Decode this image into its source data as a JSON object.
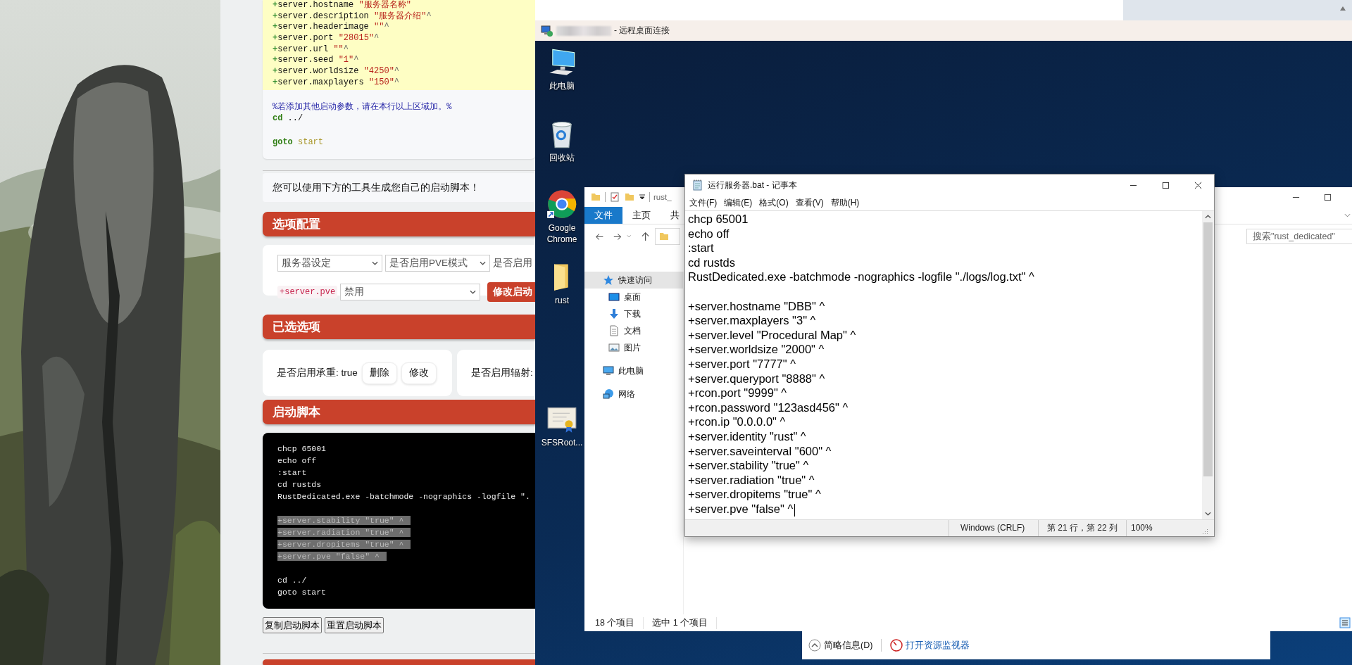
{
  "web_page": {
    "config_lines": [
      {
        "name": "+server.hostname",
        "value": "\"服务器名称\""
      },
      {
        "name": "+server.description",
        "value": "\"服务器介绍\"",
        "tail": "^"
      },
      {
        "name": "+server.headerimage",
        "value": "\"\"",
        "tail": "^"
      },
      {
        "name": "+server.port",
        "value": "\"28015\"",
        "tail": "^"
      },
      {
        "name": "+server.url",
        "value": "\"\"",
        "tail": "^"
      },
      {
        "name": "+server.seed",
        "value": "\"1\"",
        "tail": "^"
      },
      {
        "name": "+server.worldsize",
        "value": "\"4250\"",
        "tail": "^"
      },
      {
        "name": "+server.maxplayers",
        "value": "\"150\"",
        "tail": "^"
      }
    ],
    "comment": "%若添加其他启动参数，请在本行以上区域加。%",
    "footer_lines": [
      {
        "kind": "command",
        "keyword": "cd",
        "arg": "../"
      },
      {
        "kind": "blank"
      },
      {
        "kind": "jump",
        "keyword": "goto",
        "arg": "start"
      }
    ],
    "notice": "您可以使用下方的工具生成您自己的启动脚本！",
    "options_header": "选项配置",
    "selects": [
      "服务器设定",
      "是否启用PVE模式"
    ],
    "select_cut": "是否启用",
    "param_tag": "+server.pve",
    "value_select": "禁用",
    "apply_button": "修改启动",
    "selected_header": "已选选项",
    "selected_items": [
      {
        "label": "是否启用承重: true",
        "actions": [
          "删除",
          "修改"
        ]
      },
      {
        "label": "是否启用辐射:"
      }
    ],
    "script_header": "启动脚本",
    "script_lines": [
      {
        "kind": "text",
        "text": "chcp 65001",
        "highlighted": false
      },
      {
        "kind": "text",
        "text": "echo off",
        "highlighted": false
      },
      {
        "kind": "text",
        "text": ":start",
        "highlighted": false
      },
      {
        "kind": "text",
        "text": "cd rustds",
        "highlighted": false
      },
      {
        "kind": "text",
        "text": "RustDedicated.exe -batchmode -nographics -logfile \".",
        "highlighted": false
      },
      {
        "kind": "blank",
        "highlighted": false
      },
      {
        "kind": "text",
        "text": "+server.stability \"true\" ^",
        "highlighted": true
      },
      {
        "kind": "text",
        "text": "+server.radiation \"true\" ^",
        "highlighted": true
      },
      {
        "kind": "text",
        "text": "+server.dropitems \"true\" ^",
        "highlighted": true
      },
      {
        "kind": "text",
        "text": "+server.pve \"false\" ^",
        "highlighted": true
      },
      {
        "kind": "blank",
        "highlighted": false
      },
      {
        "kind": "text",
        "text": "cd ../",
        "highlighted": false
      },
      {
        "kind": "text",
        "text": "goto start",
        "highlighted": false
      }
    ],
    "script_buttons": [
      "复制启动脚本",
      "重置启动脚本"
    ]
  },
  "remote_desktop": {
    "title": "- 远程桌面连接",
    "desktop_icons": [
      {
        "kind": "computer",
        "label": "此电脑"
      },
      {
        "kind": "recycle-bin",
        "label": "回收站"
      },
      {
        "kind": "browser",
        "label": "Google Chrome"
      },
      {
        "kind": "folder",
        "label": "rust"
      },
      {
        "kind": "certificate",
        "label": "SFSRoot..."
      }
    ],
    "explorer": {
      "title": "rust_",
      "ribbon_tabs": [
        {
          "label": "文件",
          "selected": true
        },
        {
          "label": "主页",
          "selected": false
        },
        {
          "label": "共",
          "selected": false
        }
      ],
      "search": {
        "placeholder": "搜索\"rust_dedicated\""
      },
      "nav_items": [
        {
          "kind": "star",
          "label": "快速访问",
          "selected": true,
          "children": [
            {
              "kind": "desktop",
              "label": "桌面",
              "selected": false
            },
            {
              "kind": "download",
              "label": "下载",
              "selected": false
            },
            {
              "kind": "document",
              "label": "文档",
              "selected": false
            },
            {
              "kind": "picture",
              "label": "图片",
              "selected": false
            }
          ]
        },
        {
          "kind": "computer",
          "label": "此电脑",
          "selected": false
        },
        {
          "kind": "network",
          "label": "网络",
          "selected": false
        }
      ],
      "status": [
        "18 个项目",
        "选中 1 个项目"
      ]
    },
    "notepad": {
      "title": "运行服务器.bat - 记事本",
      "menu": [
        "文件(F)",
        "编辑(E)",
        "格式(O)",
        "查看(V)",
        "帮助(H)"
      ],
      "lines": [
        {
          "kind": "text",
          "text": "chcp 65001",
          "cursor": false
        },
        {
          "kind": "text",
          "text": "echo off",
          "cursor": false
        },
        {
          "kind": "text",
          "text": ":start",
          "cursor": false
        },
        {
          "kind": "text",
          "text": "cd rustds",
          "cursor": false
        },
        {
          "kind": "text",
          "text": "RustDedicated.exe -batchmode -nographics -logfile \"./logs/log.txt\" ^",
          "cursor": false
        },
        {
          "kind": "blank",
          "cursor": false
        },
        {
          "kind": "text",
          "text": "+server.hostname \"DBB\" ^",
          "cursor": false
        },
        {
          "kind": "text",
          "text": "+server.maxplayers \"3\" ^",
          "cursor": false
        },
        {
          "kind": "text",
          "text": "+server.level \"Procedural Map\" ^",
          "cursor": false
        },
        {
          "kind": "text",
          "text": "+server.worldsize \"2000\" ^",
          "cursor": false
        },
        {
          "kind": "text",
          "text": "+server.port \"7777\" ^",
          "cursor": false
        },
        {
          "kind": "text",
          "text": "+server.queryport \"8888\" ^",
          "cursor": false
        },
        {
          "kind": "text",
          "text": "+rcon.port \"9999\" ^",
          "cursor": false
        },
        {
          "kind": "text",
          "text": "+rcon.password \"123asd456\" ^",
          "cursor": false
        },
        {
          "kind": "text",
          "text": "+rcon.ip \"0.0.0.0\" ^",
          "cursor": false
        },
        {
          "kind": "text",
          "text": "+server.identity \"rust\" ^",
          "cursor": false
        },
        {
          "kind": "text",
          "text": "+server.saveinterval \"600\" ^",
          "cursor": false
        },
        {
          "kind": "text",
          "text": "+server.stability \"true\" ^",
          "cursor": false
        },
        {
          "kind": "text",
          "text": "+server.radiation \"true\" ^",
          "cursor": false
        },
        {
          "kind": "text",
          "text": "+server.dropitems \"true\" ^",
          "cursor": false
        },
        {
          "kind": "text",
          "text": "+server.pve \"false\" ^",
          "cursor": true
        }
      ],
      "status": [
        "Windows (CRLF)",
        "第 21 行，第 22 列",
        "100%"
      ]
    },
    "task_manager": {
      "details_toggle": "简略信息(D)",
      "monitor_link": "打开资源监视器"
    }
  }
}
